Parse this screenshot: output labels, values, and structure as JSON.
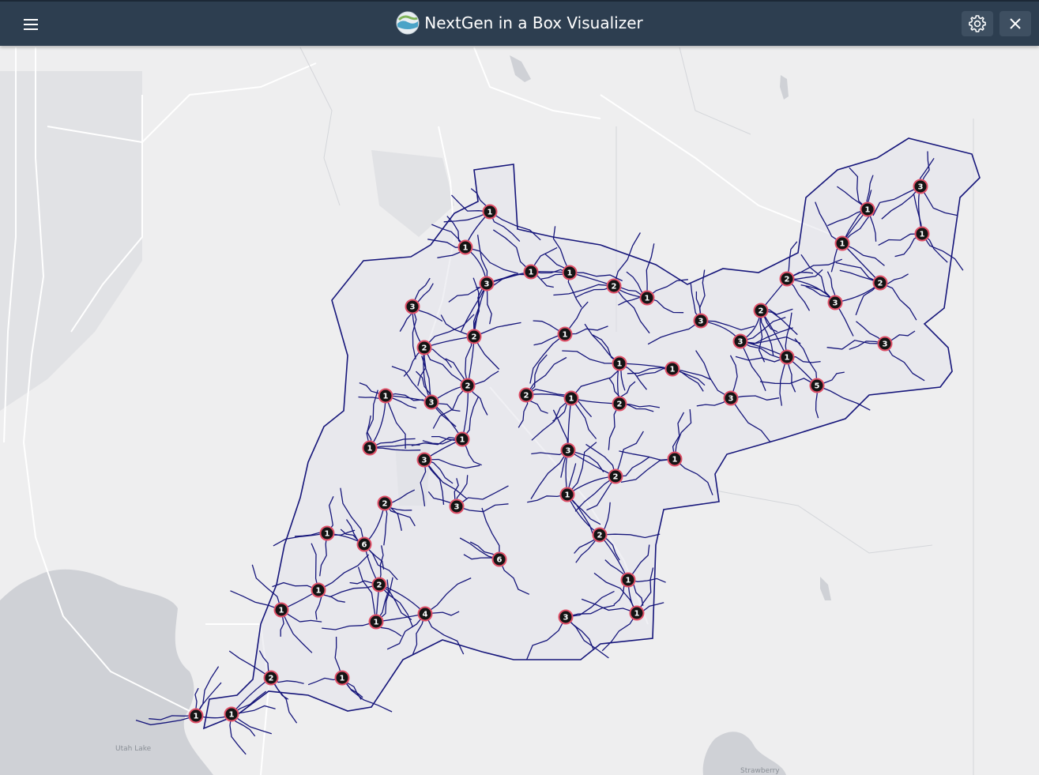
{
  "app": {
    "title": "NextGen in a Box Visualizer",
    "header_color": "#2d3e50",
    "icons": {
      "menu": "hamburger-menu-icon",
      "logo": "app-logo-icon",
      "settings": "gear-icon",
      "close": "close-icon"
    }
  },
  "map": {
    "basemap": "light-gray-canvas",
    "network_color": "#15157a",
    "labels": {
      "lake": "Utah Lake",
      "town": "Strawberry"
    },
    "marker_style": {
      "fill": "#141414",
      "stroke": "#e05068",
      "text": "#ffffff"
    },
    "cluster_counts": [
      1,
      1,
      3,
      1,
      1,
      2,
      1,
      3,
      2,
      2,
      1,
      1,
      1,
      2,
      1,
      2,
      1,
      3,
      2,
      1,
      3,
      2,
      6,
      3,
      1,
      1,
      2,
      3,
      6,
      2,
      1,
      1,
      1,
      4,
      3,
      1,
      2,
      1,
      1,
      1,
      3,
      1,
      2,
      1,
      3,
      3,
      1,
      2,
      3,
      5,
      1,
      3,
      1
    ]
  }
}
